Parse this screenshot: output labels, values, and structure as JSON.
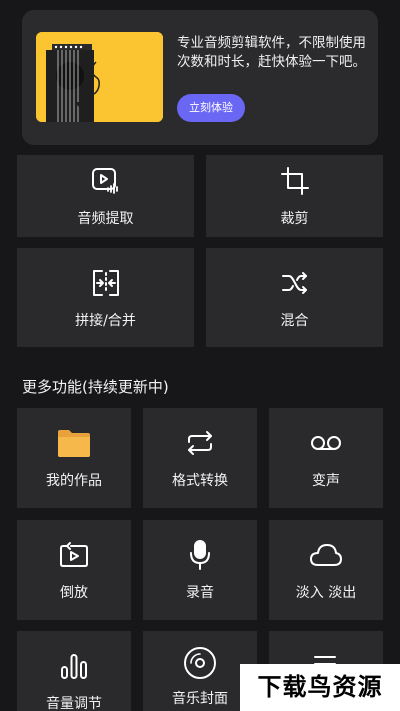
{
  "banner": {
    "description": "专业音频剪辑软件，不限制使用次数和时长，赶快体验一下吧。",
    "button": "立刻体验"
  },
  "tools": [
    {
      "label": "音频提取",
      "icon": "audio-extract-icon"
    },
    {
      "label": "裁剪",
      "icon": "crop-icon"
    },
    {
      "label": "拼接/合并",
      "icon": "merge-icon"
    },
    {
      "label": "混合",
      "icon": "shuffle-icon"
    }
  ],
  "more": {
    "title": "更多功能(持续更新中)",
    "items": [
      {
        "label": "我的作品",
        "icon": "folder-icon"
      },
      {
        "label": "格式转换",
        "icon": "repeat-icon"
      },
      {
        "label": "变声",
        "icon": "voicemail-icon"
      },
      {
        "label": "倒放",
        "icon": "reverse-play-icon"
      },
      {
        "label": "录音",
        "icon": "microphone-icon"
      },
      {
        "label": "淡入 淡出",
        "icon": "cloud-icon"
      },
      {
        "label": "音量调节",
        "icon": "volume-bars-icon"
      },
      {
        "label": "音乐封面",
        "icon": "disc-icon"
      },
      {
        "label": "",
        "icon": "list-icon"
      }
    ]
  },
  "watermark": "下载鸟资源",
  "colors": {
    "background": "#17171a",
    "tile": "#2a2a2d",
    "accent": "#6a67f5",
    "folder": "#f6b84b",
    "banner_art": "#fbc531"
  }
}
